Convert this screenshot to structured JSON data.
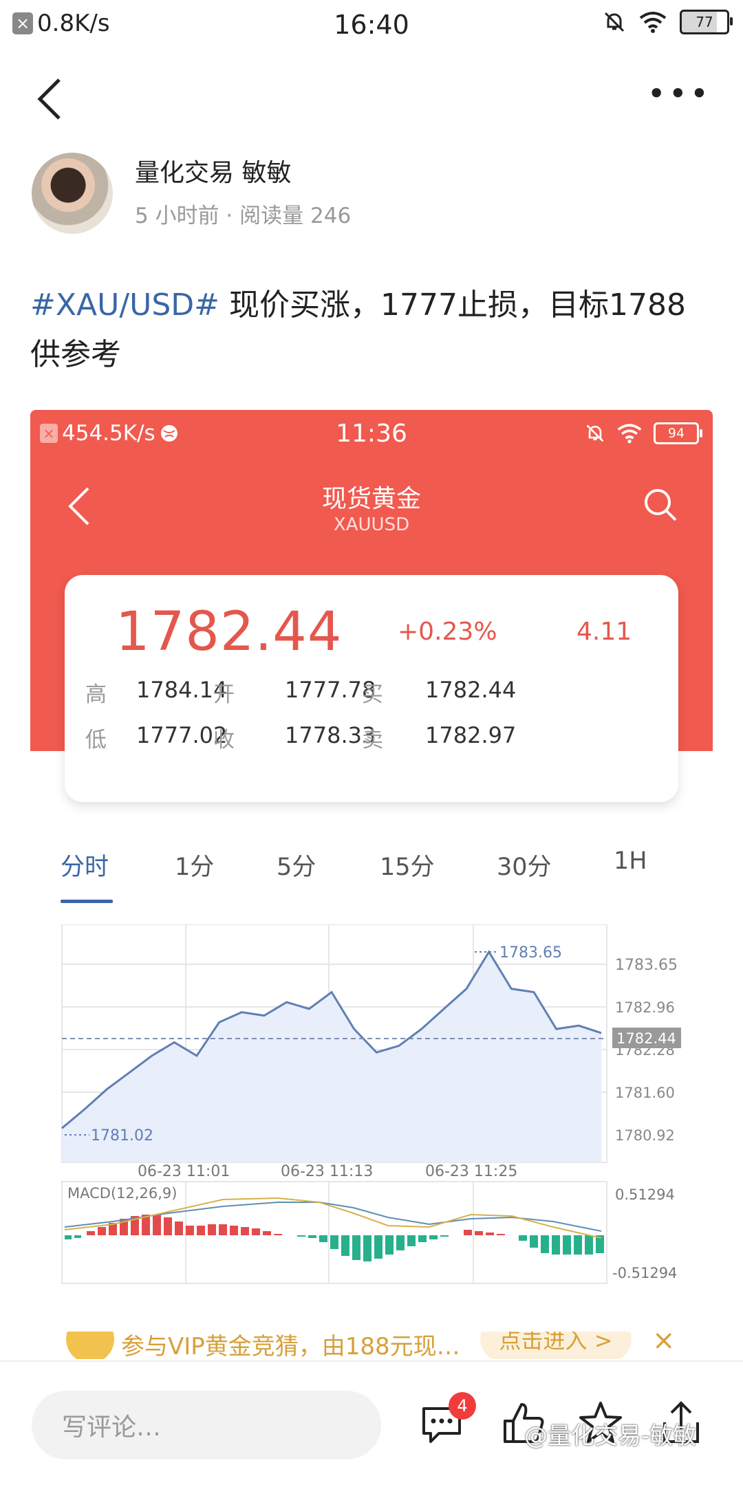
{
  "status_bar": {
    "speed": "0.8K/s",
    "time": "16:40",
    "battery": "77"
  },
  "post": {
    "author": "量化交易 敏敏",
    "meta": "5 小时前 · 阅读量 246",
    "hashtag": "#XAU/USD#",
    "text": " 现价买涨，1777止损，目标1788",
    "text2": "供参考"
  },
  "screenshot": {
    "status": {
      "speed": "454.5K/s",
      "time": "11:36",
      "battery": "94"
    },
    "title": "现货黄金",
    "subtitle": "XAUUSD",
    "quote": {
      "price": "1782.44",
      "change_pct": "+0.23%",
      "change": "4.11",
      "high_label": "高",
      "high": "1784.14",
      "open_label": "开",
      "open": "1777.78",
      "buy_label": "买",
      "buy": "1782.44",
      "low_label": "低",
      "low": "1777.02",
      "close_label": "收",
      "close": "1778.33",
      "sell_label": "卖",
      "sell": "1782.97"
    },
    "tabs": [
      "分时",
      "1分",
      "5分",
      "15分",
      "30分",
      "1H"
    ],
    "chart": {
      "y_ticks": [
        "1783.65",
        "1782.96",
        "1782.28",
        "1781.60",
        "1780.92"
      ],
      "x_ticks": [
        "06-23 11:01",
        "06-23 11:13",
        "06-23 11:25"
      ],
      "high_label": "1783.65",
      "low_label": "1781.02",
      "current": "1782.44",
      "macd_label": "MACD(12,26,9)",
      "macd_top": "0.51294",
      "macd_bottom": "-0.51294"
    }
  },
  "promo": {
    "text": "参与VIP黄金竞猜，由188元现…",
    "button": "点击进入 >"
  },
  "bottom": {
    "comment_placeholder": "写评论…",
    "comment_count": "4",
    "watermark": "@量化交易-敏敏"
  },
  "chart_data": {
    "type": "line",
    "x": [
      "10:50",
      "10:52",
      "10:54",
      "10:56",
      "10:58",
      "11:00",
      "11:01",
      "11:03",
      "11:05",
      "11:07",
      "11:09",
      "11:11",
      "11:13",
      "11:15",
      "11:17",
      "11:19",
      "11:21",
      "11:23",
      "11:25",
      "11:27",
      "11:29",
      "11:31",
      "11:33",
      "11:35",
      "11:36"
    ],
    "series": [
      {
        "values": [
          1781.02,
          1781.3,
          1781.6,
          1781.85,
          1782.1,
          1782.3,
          1782.1,
          1782.6,
          1782.75,
          1782.7,
          1782.9,
          1782.8,
          1783.05,
          1782.5,
          1782.15,
          1782.25,
          1782.5,
          1782.8,
          1783.1,
          1783.65,
          1783.1,
          1783.05,
          1782.5,
          1782.55,
          1782.44
        ]
      }
    ],
    "ylim": [
      1780.92,
      1783.65
    ],
    "x_ticks": [
      "06-23 11:01",
      "06-23 11:13",
      "06-23 11:25"
    ]
  }
}
